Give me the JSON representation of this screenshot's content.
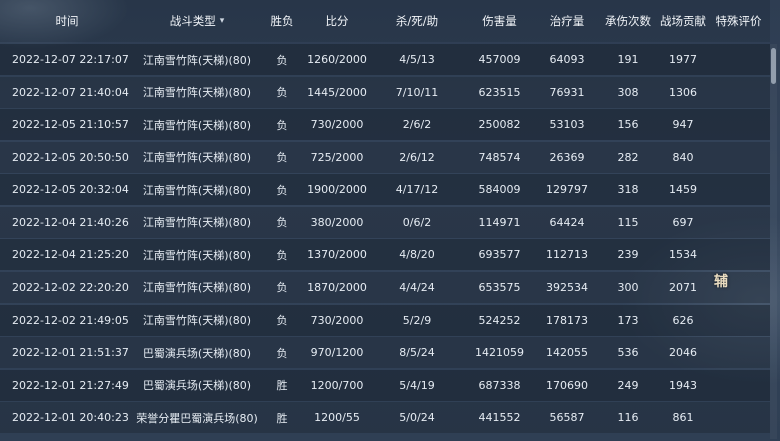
{
  "headers": {
    "time": "时间",
    "type": "战斗类型",
    "type_sort_icon": "chevron-down-icon",
    "result": "胜负",
    "score": "比分",
    "kda": "杀/死/助",
    "damage": "伤害量",
    "healing": "治疗量",
    "tanked": "承伤次数",
    "contribution": "战场贡献",
    "special": "特殊评价"
  },
  "rows": [
    {
      "time": "2022-12-07 22:17:07",
      "type": "江南雪竹阵(天梯)(80)",
      "result": "负",
      "score": "1260/2000",
      "kda": "4/5/13",
      "damage": "457009",
      "healing": "64093",
      "tanked": "191",
      "contribution": "1977",
      "special": ""
    },
    {
      "time": "2022-12-07 21:40:04",
      "type": "江南雪竹阵(天梯)(80)",
      "result": "负",
      "score": "1445/2000",
      "kda": "7/10/11",
      "damage": "623515",
      "healing": "76931",
      "tanked": "308",
      "contribution": "1306",
      "special": ""
    },
    {
      "time": "2022-12-05 21:10:57",
      "type": "江南雪竹阵(天梯)(80)",
      "result": "负",
      "score": "730/2000",
      "kda": "2/6/2",
      "damage": "250082",
      "healing": "53103",
      "tanked": "156",
      "contribution": "947",
      "special": ""
    },
    {
      "time": "2022-12-05 20:50:50",
      "type": "江南雪竹阵(天梯)(80)",
      "result": "负",
      "score": "725/2000",
      "kda": "2/6/12",
      "damage": "748574",
      "healing": "26369",
      "tanked": "282",
      "contribution": "840",
      "special": ""
    },
    {
      "time": "2022-12-05 20:32:04",
      "type": "江南雪竹阵(天梯)(80)",
      "result": "负",
      "score": "1900/2000",
      "kda": "4/17/12",
      "damage": "584009",
      "healing": "129797",
      "tanked": "318",
      "contribution": "1459",
      "special": ""
    },
    {
      "time": "2022-12-04 21:40:26",
      "type": "江南雪竹阵(天梯)(80)",
      "result": "负",
      "score": "380/2000",
      "kda": "0/6/2",
      "damage": "114971",
      "healing": "64424",
      "tanked": "115",
      "contribution": "697",
      "special": ""
    },
    {
      "time": "2022-12-04 21:25:20",
      "type": "江南雪竹阵(天梯)(80)",
      "result": "负",
      "score": "1370/2000",
      "kda": "4/8/20",
      "damage": "693577",
      "healing": "112713",
      "tanked": "239",
      "contribution": "1534",
      "special": ""
    },
    {
      "time": "2022-12-02 22:20:20",
      "type": "江南雪竹阵(天梯)(80)",
      "result": "负",
      "score": "1870/2000",
      "kda": "4/4/24",
      "damage": "653575",
      "healing": "392534",
      "tanked": "300",
      "contribution": "2071",
      "special": ""
    },
    {
      "time": "2022-12-02 21:49:05",
      "type": "江南雪竹阵(天梯)(80)",
      "result": "负",
      "score": "730/2000",
      "kda": "5/2/9",
      "damage": "524252",
      "healing": "178173",
      "tanked": "173",
      "contribution": "626",
      "special": ""
    },
    {
      "time": "2022-12-01 21:51:37",
      "type": "巴蜀演兵场(天梯)(80)",
      "result": "负",
      "score": "970/1200",
      "kda": "8/5/24",
      "damage": "1421059",
      "healing": "142055",
      "tanked": "536",
      "contribution": "2046",
      "special": ""
    },
    {
      "time": "2022-12-01 21:27:49",
      "type": "巴蜀演兵场(天梯)(80)",
      "result": "胜",
      "score": "1200/700",
      "kda": "5/4/19",
      "damage": "687338",
      "healing": "170690",
      "tanked": "249",
      "contribution": "1943",
      "special": ""
    },
    {
      "time": "2022-12-01 20:40:23",
      "type": "荣誉分瞿巴蜀演兵场(80)",
      "result": "胜",
      "score": "1200/55",
      "kda": "5/0/24",
      "damage": "441552",
      "healing": "56587",
      "tanked": "116",
      "contribution": "861",
      "special": ""
    }
  ],
  "decoration": {
    "char": "辅"
  }
}
